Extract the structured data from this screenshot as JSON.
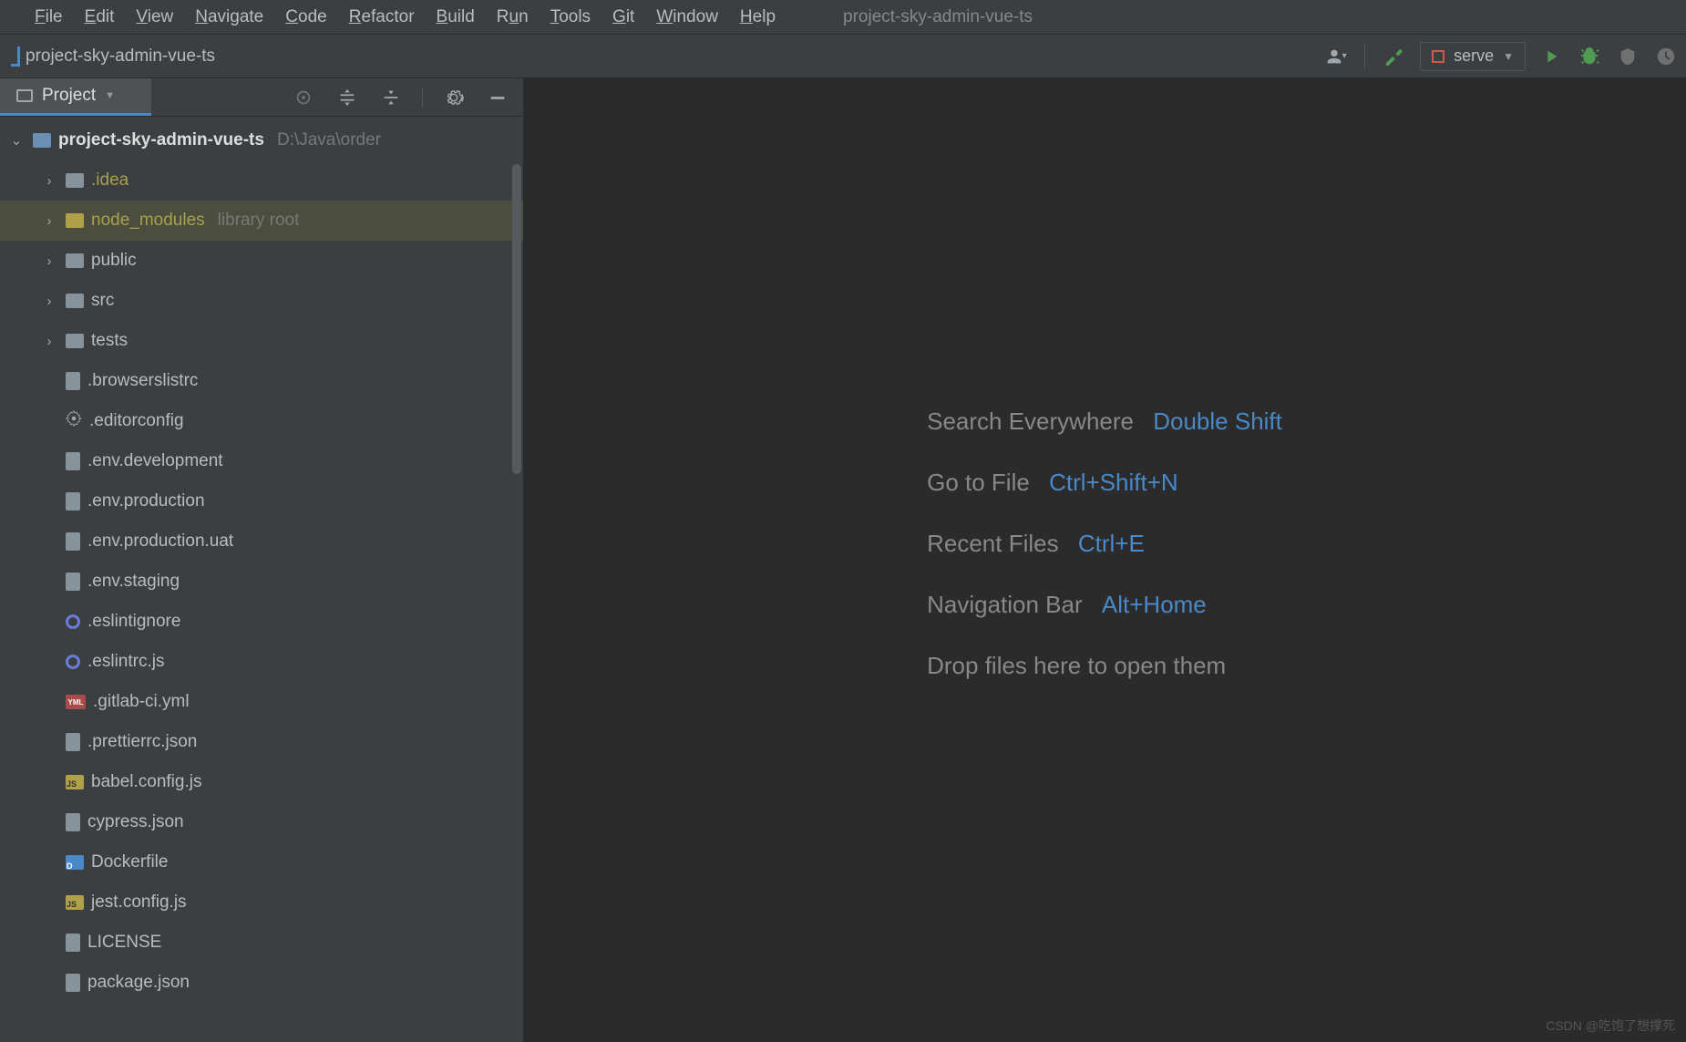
{
  "window_title": "project-sky-admin-vue-ts",
  "menu": {
    "file": "File",
    "edit": "Edit",
    "view": "View",
    "navigate": "Navigate",
    "code": "Code",
    "refactor": "Refactor",
    "build": "Build",
    "run": "Run",
    "tools": "Tools",
    "git": "Git",
    "window": "Window",
    "help": "Help"
  },
  "breadcrumb": {
    "root": "project-sky-admin-vue-ts"
  },
  "run_config": {
    "label": "serve"
  },
  "project_tool": {
    "title": "Project"
  },
  "tree": {
    "root_name": "project-sky-admin-vue-ts",
    "root_path": "D:\\Java\\order",
    "idea": ".idea",
    "node_modules": "node_modules",
    "node_modules_hint": "library root",
    "public": "public",
    "src": "src",
    "tests": "tests",
    "browserslistrc": ".browserslistrc",
    "editorconfig": ".editorconfig",
    "env_dev": ".env.development",
    "env_prod": ".env.production",
    "env_prod_uat": ".env.production.uat",
    "env_staging": ".env.staging",
    "eslintignore": ".eslintignore",
    "eslintrc": ".eslintrc.js",
    "gitlab_ci": ".gitlab-ci.yml",
    "prettierrc": ".prettierrc.json",
    "babel_config": "babel.config.js",
    "cypress_json": "cypress.json",
    "dockerfile": "Dockerfile",
    "jest_config": "jest.config.js",
    "license": "LICENSE",
    "package_json": "package.json"
  },
  "welcome": {
    "search_label": "Search Everywhere",
    "search_shortcut": "Double Shift",
    "gotofile_label": "Go to File",
    "gotofile_shortcut": "Ctrl+Shift+N",
    "recent_label": "Recent Files",
    "recent_shortcut": "Ctrl+E",
    "navbar_label": "Navigation Bar",
    "navbar_shortcut": "Alt+Home",
    "drop_hint": "Drop files here to open them"
  },
  "watermark": "CSDN @吃饱了想撑死"
}
